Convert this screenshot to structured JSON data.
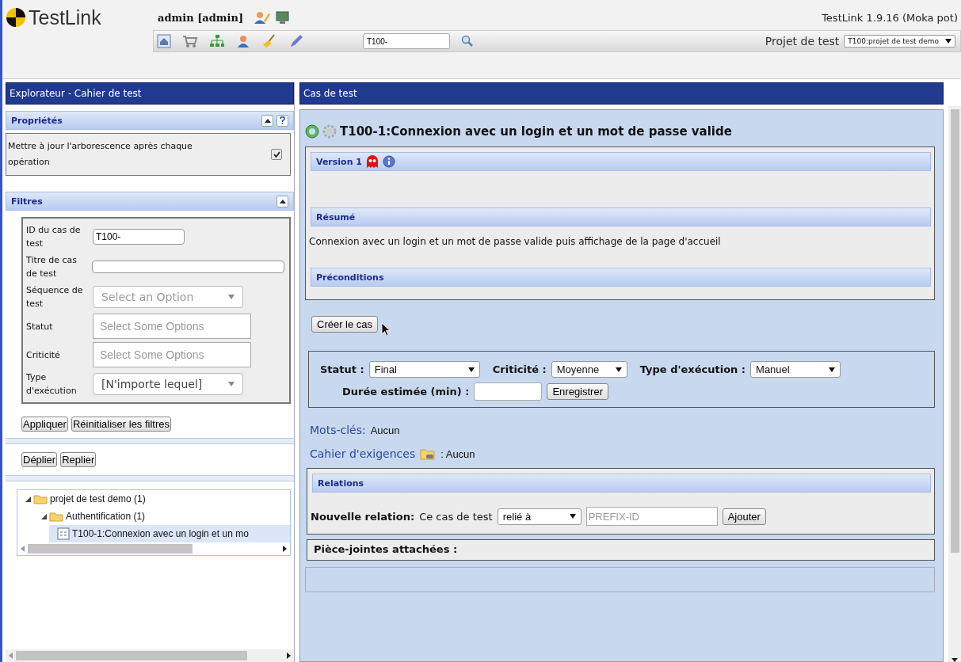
{
  "header": {
    "logo": "TestLink",
    "user": "admin [admin]",
    "version": "TestLink 1.9.16 (Moka pot)",
    "search": {
      "value": "T100-"
    },
    "project_label": "Projet de test",
    "project_select": "T100:projet de test demo"
  },
  "left_panel": {
    "title": "Explorateur - Cahier de test",
    "properties": {
      "title": "Propriétés",
      "option": {
        "label": "Mettre à jour l'arborescence après chaque opération",
        "checked": true
      }
    },
    "filters": {
      "title": "Filtres",
      "fields": [
        {
          "kind": "text",
          "label": "ID du cas de test",
          "value": "T100-"
        },
        {
          "kind": "text",
          "label": "Titre de cas de test"
        },
        {
          "kind": "select",
          "label": "Séquence de test",
          "placeholder": "Select an Option"
        },
        {
          "kind": "multi",
          "label": "Statut",
          "placeholder": "Select Some Options"
        },
        {
          "kind": "multi",
          "label": "Criticité",
          "placeholder": "Select Some Options"
        },
        {
          "kind": "select",
          "label": "Type d'exécution",
          "value": "[N'importe lequel]"
        }
      ],
      "buttons": [
        "Appliquer",
        "Réinitialiser les filtres"
      ]
    },
    "tree_buttons": [
      "Déplier",
      "Replier"
    ],
    "tree": [
      {
        "label": "projet de test demo (1)",
        "kind": "folder",
        "expanded": true,
        "selected": false,
        "children": [
          {
            "label": "Authentification (1)",
            "kind": "folder",
            "expanded": true,
            "selected": false,
            "children": [
              {
                "label": "T100-1:Connexion avec un login et un mo",
                "kind": "testcase",
                "selected": true
              }
            ]
          }
        ]
      }
    ]
  },
  "right_panel": {
    "title": "Cas de test",
    "case_title": "T100-1:Connexion avec un login et un mot de passe valide",
    "version": "Version 1",
    "summary_title": "Résumé",
    "summary": "Connexion avec un login et un mot de passe valide puis affichage de la page d'accueil",
    "preconditions_title": "Préconditions",
    "create_button": "Créer le cas",
    "attributes": [
      {
        "label": "Statut :",
        "value": "Final"
      },
      {
        "label": "Criticité :",
        "value": "Moyenne"
      },
      {
        "label": "Type d'exécution :",
        "value": "Manuel"
      }
    ],
    "duration_label": "Durée estimée (min) :",
    "save_button": "Enregistrer",
    "keywords_label": "Mots-clés:",
    "keywords_value": "Aucun",
    "requirements_label": "Cahier d'exigences",
    "requirements_value": ": Aucun",
    "relations_title": "Relations",
    "relation_label": "Nouvelle relation:",
    "relation_text": "Ce cas de test",
    "relation_select": "relié à",
    "relation_placeholder": "PREFIX-ID",
    "add_button": "Ajouter",
    "attachments_title": "Pièce-jointes attachées :"
  }
}
